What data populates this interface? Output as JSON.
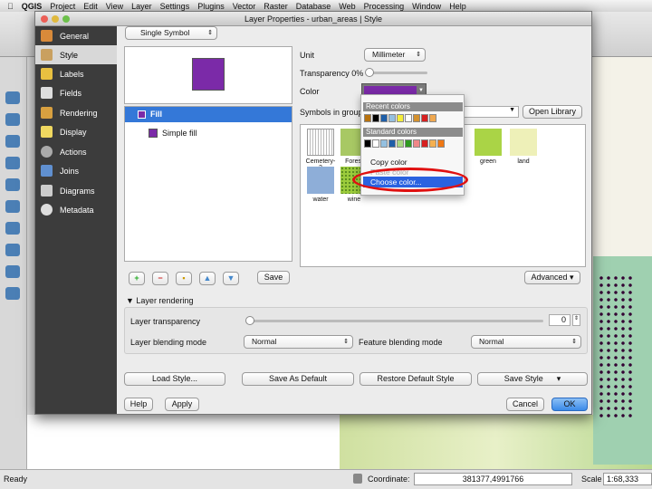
{
  "menubar": {
    "app": "QGIS",
    "items": [
      "Project",
      "Edit",
      "View",
      "Layer",
      "Settings",
      "Plugins",
      "Vector",
      "Raster",
      "Database",
      "Web",
      "Processing",
      "Window",
      "Help"
    ]
  },
  "dialog": {
    "title": "Layer Properties - urban_areas | Style",
    "sidebar": [
      {
        "label": "General",
        "icon": "wrench-icon"
      },
      {
        "label": "Style",
        "icon": "brush-icon"
      },
      {
        "label": "Labels",
        "icon": "labels-icon"
      },
      {
        "label": "Fields",
        "icon": "table-icon"
      },
      {
        "label": "Rendering",
        "icon": "brush-icon"
      },
      {
        "label": "Display",
        "icon": "speech-icon"
      },
      {
        "label": "Actions",
        "icon": "gear-icon"
      },
      {
        "label": "Joins",
        "icon": "joins-icon"
      },
      {
        "label": "Diagrams",
        "icon": "diagram-icon"
      },
      {
        "label": "Metadata",
        "icon": "info-icon"
      }
    ],
    "renderer": "Single Symbol",
    "symbol_color": "#7b2aa8",
    "tree": {
      "fill": "Fill",
      "simple_fill": "Simple fill"
    },
    "unit_label": "Unit",
    "unit_value": "Millimeter",
    "transparency_label": "Transparency 0%",
    "transparency": 0,
    "color_label": "Color",
    "symbols_in_group": "Symbols in group",
    "open_library": "Open Library",
    "symbols": [
      {
        "name": "Cemetery-2",
        "color": "#f0f0f0"
      },
      {
        "name": "Forest",
        "color": "#a8c864"
      },
      {
        "name": "green",
        "color": "#aad446"
      },
      {
        "name": "land",
        "color": "#eef0b8"
      },
      {
        "name": "water",
        "color": "#8eaed8"
      },
      {
        "name": "wine",
        "color": "#9ccc3c"
      }
    ],
    "save": "Save",
    "advanced": "Advanced",
    "layer_rendering": "Layer rendering",
    "layer_transparency": "Layer transparency",
    "layer_transparency_value": "0",
    "layer_blending": "Layer blending mode",
    "layer_blending_value": "Normal",
    "feature_blending": "Feature blending mode",
    "feature_blending_value": "Normal",
    "load_style": "Load Style...",
    "save_default": "Save As Default",
    "restore_default": "Restore Default Style",
    "save_style": "Save Style",
    "help": "Help",
    "apply": "Apply",
    "cancel": "Cancel",
    "ok": "OK"
  },
  "popup": {
    "recent": "Recent colors",
    "recent_colors": [
      "#b8720e",
      "#000000",
      "#1f5fa8",
      "#94c0e0",
      "#f5ee3a",
      "#ffffff",
      "#d4912e",
      "#d62020",
      "#f0a850"
    ],
    "standard": "Standard colors",
    "standard_colors": [
      "#000000",
      "#ffffff",
      "#94c0e0",
      "#1f5fa8",
      "#a8d880",
      "#2e9a20",
      "#f08888",
      "#d62020",
      "#f5b050",
      "#f07814"
    ],
    "copy": "Copy color",
    "paste": "Paste color",
    "choose": "Choose color..."
  },
  "status": {
    "ready": "Ready",
    "coordinate_label": "Coordinate:",
    "coordinate": "381377,4991766",
    "scale_label": "Scale",
    "scale": "1:68,333"
  }
}
